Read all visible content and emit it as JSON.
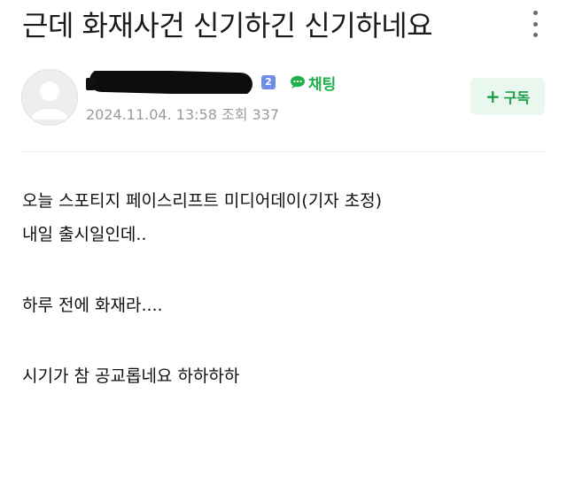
{
  "post": {
    "title": "근데 화재사건 신기하긴 신기하네요",
    "author": {
      "name": "",
      "level": "2",
      "chat_label": "채팅",
      "date": "2024.11.04. 13:58",
      "views_label": "조회",
      "views": "337"
    },
    "subscribe_label": "구독",
    "body": [
      "오늘 스포티지 페이스리프트 미디어데이(기자 초정)",
      "내일 출시일인데..",
      "",
      "하루 전에 화재라....",
      "",
      "시기가 참 공교롭네요 하하하하"
    ]
  },
  "colors": {
    "accent_green": "#1fb14b",
    "badge_blue": "#6c8fe6",
    "subscribe_bg": "#eaf7ee"
  },
  "icons": {
    "menu": "vertical-ellipsis-icon",
    "avatar": "default-user-icon",
    "chat": "chat-bubble-icon",
    "subscribe": "plus-icon"
  }
}
